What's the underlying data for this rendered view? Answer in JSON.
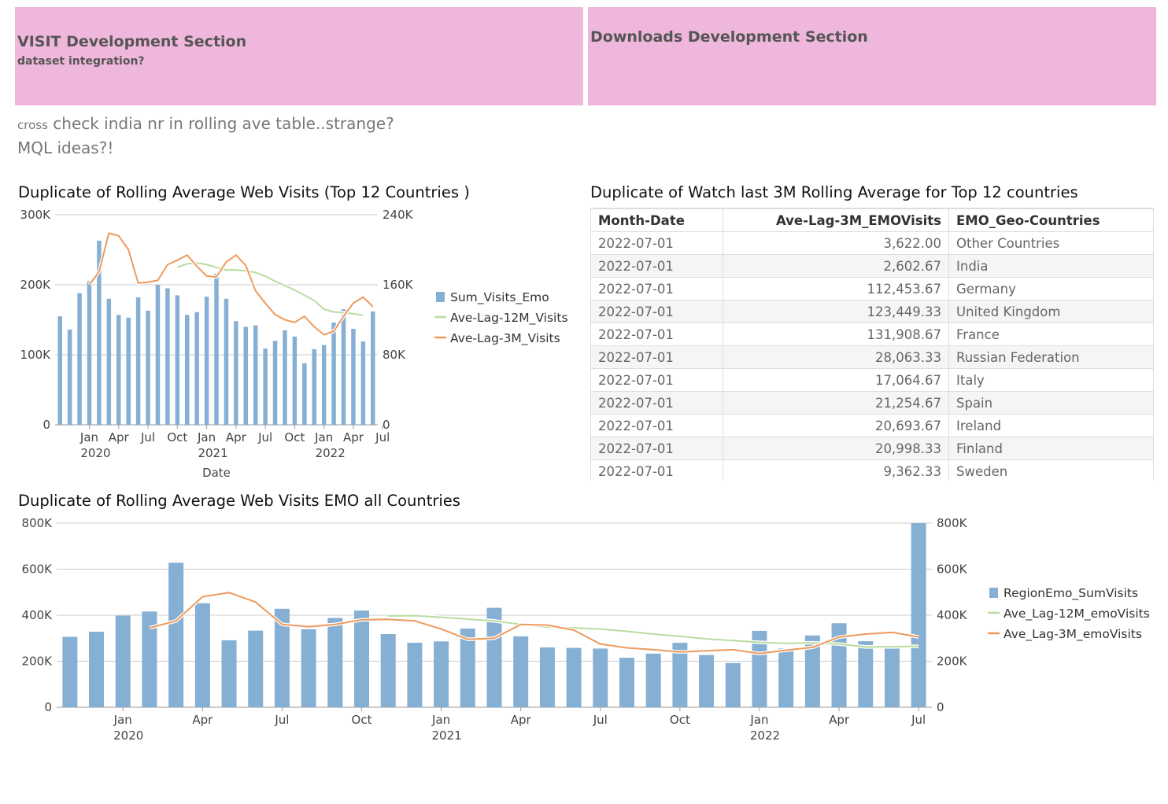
{
  "colors": {
    "bar": "#86afd4",
    "lag12": "#b9dca0",
    "lag3": "#ee9a5c",
    "banner": "#f0b7dc",
    "grid": "#cccccc"
  },
  "banners": [
    {
      "title": "VISIT Development Section",
      "subtitle": "dataset integration?"
    },
    {
      "title": "Downloads Development Section",
      "subtitle": ""
    }
  ],
  "notes": {
    "line1_small": "cross",
    "line1": "check india nr in rolling ave table..strange?",
    "line2": "MQL ideas?!"
  },
  "chart_top": {
    "title": "Duplicate of Rolling Average  Web Visits (Top 12 Countries )",
    "xlabel": "Date",
    "left_ticks": [
      "0",
      "100K",
      "200K",
      "300K"
    ],
    "right_ticks": [
      "0",
      "80K",
      "160K",
      "240K"
    ],
    "x_ticks": [
      {
        "label": "Jan",
        "year": "2020"
      },
      {
        "label": "Apr",
        "year": ""
      },
      {
        "label": "Jul",
        "year": ""
      },
      {
        "label": "Oct",
        "year": ""
      },
      {
        "label": "Jan",
        "year": "2021"
      },
      {
        "label": "Apr",
        "year": ""
      },
      {
        "label": "Jul",
        "year": ""
      },
      {
        "label": "Oct",
        "year": ""
      },
      {
        "label": "Jan",
        "year": "2022"
      },
      {
        "label": "Apr",
        "year": ""
      },
      {
        "label": "Jul",
        "year": ""
      }
    ],
    "legend": [
      "Sum_Visits_Emo",
      "Ave-Lag-12M_Visits",
      "Ave-Lag-3M_Visits"
    ]
  },
  "chart_bottom": {
    "title": "Duplicate of Rolling Average  Web Visits EMO all Countries",
    "left_ticks": [
      "0",
      "200K",
      "400K",
      "600K",
      "800K"
    ],
    "right_ticks": [
      "0",
      "200K",
      "400K",
      "600K",
      "800K"
    ],
    "x_ticks": [
      {
        "label": "Jan",
        "year": "2020"
      },
      {
        "label": "Apr",
        "year": ""
      },
      {
        "label": "Jul",
        "year": ""
      },
      {
        "label": "Oct",
        "year": ""
      },
      {
        "label": "Jan",
        "year": "2021"
      },
      {
        "label": "Apr",
        "year": ""
      },
      {
        "label": "Jul",
        "year": ""
      },
      {
        "label": "Oct",
        "year": ""
      },
      {
        "label": "Jan",
        "year": "2022"
      },
      {
        "label": "Apr",
        "year": ""
      },
      {
        "label": "Jul",
        "year": ""
      }
    ],
    "legend": [
      "RegionEmo_SumVisits",
      "Ave_Lag-12M_emoVisits",
      "Ave_Lag-3M_emoVisits"
    ]
  },
  "table": {
    "title": "Duplicate of Watch last 3M Rolling Average  for Top 12 countries",
    "headers": [
      "Month-Date",
      "Ave-Lag-3M_EMOVisits",
      "EMO_Geo-Countries"
    ],
    "rows": [
      [
        "2022-07-01",
        "3,622.00",
        "Other Countries"
      ],
      [
        "2022-07-01",
        "2,602.67",
        "India"
      ],
      [
        "2022-07-01",
        "112,453.67",
        "Germany"
      ],
      [
        "2022-07-01",
        "123,449.33",
        "United Kingdom"
      ],
      [
        "2022-07-01",
        "131,908.67",
        "France"
      ],
      [
        "2022-07-01",
        "28,063.33",
        "Russian Federation"
      ],
      [
        "2022-07-01",
        "17,064.67",
        "Italy"
      ],
      [
        "2022-07-01",
        "21,254.67",
        "Spain"
      ],
      [
        "2022-07-01",
        "20,693.67",
        "Ireland"
      ],
      [
        "2022-07-01",
        "20,998.33",
        "Finland"
      ],
      [
        "2022-07-01",
        "9,362.33",
        "Sweden"
      ]
    ]
  },
  "chart_data": [
    {
      "type": "bar",
      "title": "Duplicate of Rolling Average  Web Visits (Top 12 Countries )",
      "xlabel": "Date",
      "x_start": "2019-10",
      "x_end": "2022-07",
      "ylim": [
        0,
        300000
      ],
      "y2lim": [
        0,
        240000
      ],
      "series": [
        {
          "name": "Sum_Visits_Emo",
          "axis": "left",
          "type": "bar",
          "values": [
            155000,
            136000,
            188000,
            205000,
            263000,
            180000,
            157000,
            153000,
            182000,
            163000,
            200000,
            195000,
            185000,
            157000,
            161000,
            183000,
            216000,
            180000,
            148000,
            140000,
            142000,
            109000,
            120000,
            135000,
            126000,
            88000,
            108000,
            114000,
            146000,
            165000,
            137000,
            119000,
            162000
          ]
        },
        {
          "name": "Ave-Lag-12M_Visits",
          "axis": "right",
          "type": "line",
          "x_offset": 12,
          "values": [
            180000,
            184000,
            185000,
            183000,
            180000,
            177000,
            177000,
            176000,
            174000,
            170000,
            164000,
            159000,
            154000,
            148000,
            142000,
            132000,
            129000,
            128000,
            127000,
            125000
          ]
        },
        {
          "name": "Ave-Lag-3M_Visits",
          "axis": "right",
          "type": "line",
          "x_offset": 3,
          "values": [
            160000,
            175000,
            219000,
            216000,
            200000,
            162000,
            163000,
            165000,
            183000,
            188000,
            194000,
            181000,
            170000,
            169000,
            186000,
            194000,
            182000,
            153000,
            139000,
            126000,
            120000,
            117000,
            124000,
            112000,
            103000,
            107000,
            124000,
            139000,
            146000,
            135000
          ]
        }
      ]
    },
    {
      "type": "bar",
      "title": "Duplicate of Rolling Average  Web Visits EMO all Countries",
      "x_start": "2019-11",
      "x_end": "2022-07",
      "ylim": [
        0,
        800000
      ],
      "y2lim": [
        0,
        800000
      ],
      "series": [
        {
          "name": "RegionEmo_SumVisits",
          "axis": "left",
          "type": "bar",
          "values": [
            306000,
            328000,
            398000,
            416000,
            628000,
            452000,
            291000,
            333000,
            428000,
            339000,
            388000,
            420000,
            318000,
            280000,
            286000,
            342000,
            432000,
            308000,
            260000,
            258000,
            255000,
            215000,
            233000,
            280000,
            227000,
            192000,
            332000,
            255000,
            312000,
            365000,
            287000,
            255000,
            800000
          ]
        },
        {
          "name": "Ave_Lag-12M_emoVisits",
          "axis": "right",
          "type": "line",
          "x_offset": 12,
          "values": [
            397000,
            398000,
            391000,
            383000,
            375000,
            360000,
            348000,
            345000,
            340000,
            330000,
            318000,
            308000,
            297000,
            290000,
            282000,
            278000,
            280000,
            275000,
            262000,
            263000,
            265000
          ]
        },
        {
          "name": "Ave_Lag-3M_emoVisits",
          "axis": "right",
          "type": "line",
          "x_offset": 3,
          "values": [
            345000,
            375000,
            480000,
            498000,
            457000,
            360000,
            350000,
            360000,
            380000,
            382000,
            375000,
            340000,
            295000,
            300000,
            360000,
            357000,
            335000,
            275000,
            258000,
            250000,
            240000,
            245000,
            250000,
            233000,
            248000,
            260000,
            305000,
            318000,
            325000,
            306000
          ]
        }
      ]
    }
  ]
}
